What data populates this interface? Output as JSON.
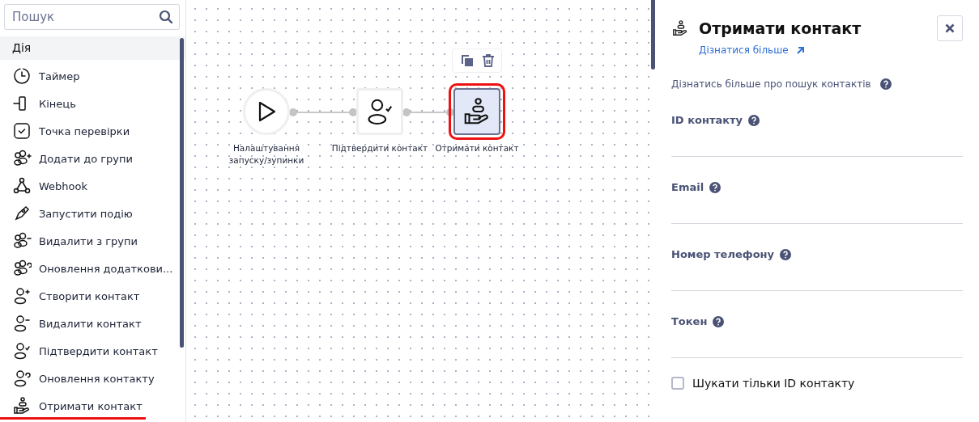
{
  "search": {
    "placeholder": "Пошук"
  },
  "sidebar": {
    "section": "Дія",
    "items": [
      {
        "label": "Таймер",
        "kind": "timer",
        "selected": false
      },
      {
        "label": "Кінець",
        "kind": "end",
        "selected": false
      },
      {
        "label": "Точка перевірки",
        "kind": "checkpoint",
        "selected": false
      },
      {
        "label": "Додати до групи",
        "kind": "group-add",
        "selected": false
      },
      {
        "label": "Webhook",
        "kind": "webhook",
        "selected": false
      },
      {
        "label": "Запустити подію",
        "kind": "event",
        "selected": false
      },
      {
        "label": "Видалити з групи",
        "kind": "group-remove",
        "selected": false
      },
      {
        "label": "Оновлення додаткови...",
        "kind": "group-update",
        "selected": false
      },
      {
        "label": "Створити контакт",
        "kind": "contact-add",
        "selected": false
      },
      {
        "label": "Видалити контакт",
        "kind": "contact-remove",
        "selected": false
      },
      {
        "label": "Підтвердити контакт",
        "kind": "contact-confirm",
        "selected": false
      },
      {
        "label": "Оновлення контакту",
        "kind": "contact-update",
        "selected": false
      },
      {
        "label": "Отримати контакт",
        "kind": "contact-get",
        "selected": true
      }
    ]
  },
  "canvas": {
    "nodes": [
      {
        "label": "Налаштування запуску/зупинки",
        "kind": "start",
        "selected": false
      },
      {
        "label": "Підтвердити контакт",
        "kind": "contact-confirm",
        "selected": false
      },
      {
        "label": "Отримати контакт",
        "kind": "contact-get",
        "selected": true
      }
    ]
  },
  "panel": {
    "title": "Отримати контакт",
    "link": "Дізнатися більше",
    "description": "Дізнатись більше про пошук контактів",
    "fields": [
      {
        "label": "ID контакту"
      },
      {
        "label": "Email"
      },
      {
        "label": "Номер телефону"
      },
      {
        "label": "Токен"
      }
    ],
    "checkbox": {
      "label": "Шукати тільки ID контакту",
      "checked": false
    }
  }
}
